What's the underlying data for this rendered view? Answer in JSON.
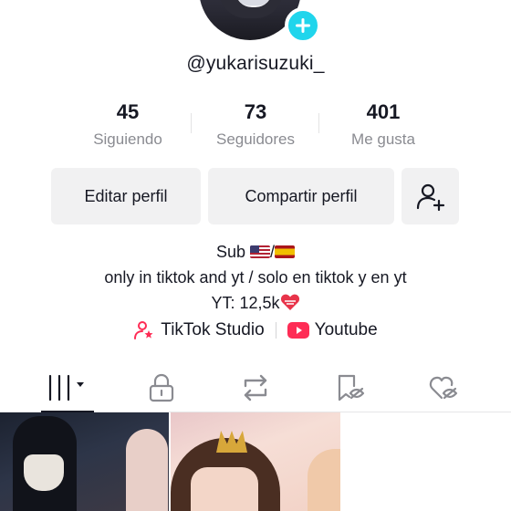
{
  "profile": {
    "username": "@yukarisuzuki_"
  },
  "stats": [
    {
      "value": "45",
      "label": "Siguiendo"
    },
    {
      "value": "73",
      "label": "Seguidores"
    },
    {
      "value": "401",
      "label": "Me gusta"
    }
  ],
  "actions": {
    "edit_label": "Editar perfil",
    "share_label": "Compartir perfil",
    "add_friends_icon": "add-user-icon"
  },
  "bio": {
    "line1": "Sub",
    "line1_sep": "/",
    "line2": "only in tiktok and yt / solo en tiktok y en yt",
    "line3": "YT: 12,5k"
  },
  "links": [
    {
      "label": "TikTok Studio",
      "icon": "tiktok-studio-icon",
      "color": "#fe2c55"
    },
    {
      "label": "Youtube",
      "icon": "youtube-icon",
      "color": "#fe2c55"
    }
  ],
  "tabs": [
    {
      "name": "videos",
      "icon": "grid-icon",
      "active": true
    },
    {
      "name": "private",
      "icon": "lock-icon",
      "active": false
    },
    {
      "name": "reposts",
      "icon": "repost-icon",
      "active": false
    },
    {
      "name": "favorites",
      "icon": "bookmark-hidden-icon",
      "active": false
    },
    {
      "name": "liked",
      "icon": "heart-hidden-icon",
      "active": false
    }
  ],
  "colors": {
    "accent": "#20d5ec",
    "brand_red": "#fe2c55",
    "text": "#161823",
    "muted": "#8a8b91",
    "button_bg": "#f1f1f2"
  }
}
